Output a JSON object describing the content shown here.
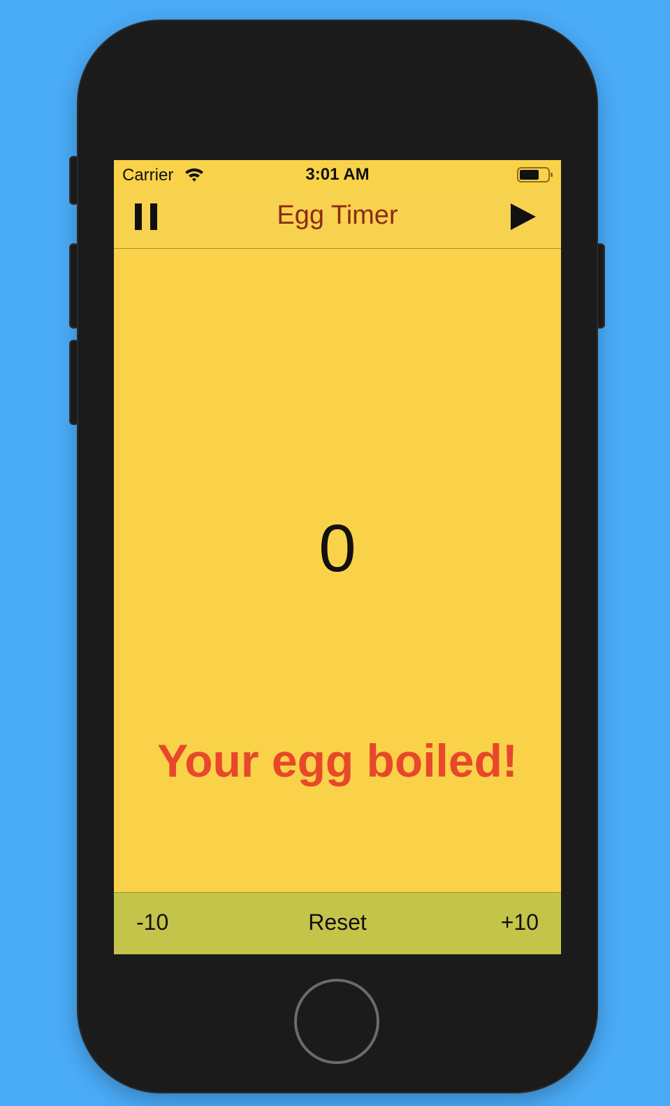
{
  "status_bar": {
    "carrier": "Carrier",
    "time": "3:01 AM",
    "wifi_icon": "wifi-icon",
    "battery_icon": "battery-icon"
  },
  "nav_bar": {
    "title": "Egg Timer",
    "left_icon": "pause-icon",
    "right_icon": "play-icon"
  },
  "main": {
    "counter": "0",
    "message": "Your egg boiled!"
  },
  "toolbar": {
    "minus_label": "-10",
    "reset_label": "Reset",
    "plus_label": "+10"
  },
  "colors": {
    "background": "#4aabf7",
    "screen": "#f9d249",
    "title": "#8e2a14",
    "message": "#e8472a",
    "toolbar": "#c5c44a"
  }
}
